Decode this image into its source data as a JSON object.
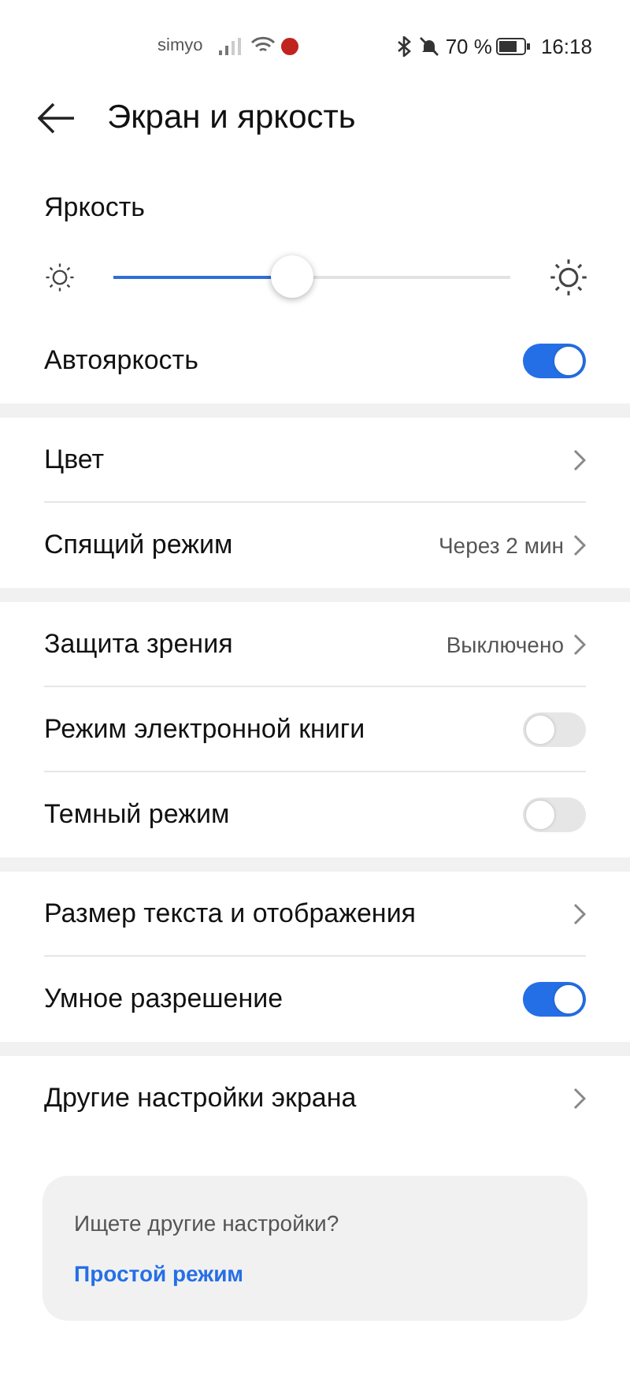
{
  "status_bar": {
    "carrier": "simyo",
    "battery": "70 %",
    "time": "16:18"
  },
  "header": {
    "title": "Экран и яркость"
  },
  "brightness": {
    "label": "Яркость",
    "level": 0.45
  },
  "auto_brightness": {
    "label": "Автояркость",
    "on": true
  },
  "sections": [
    {
      "rows": [
        {
          "kind": "link",
          "label": "Цвет"
        },
        {
          "kind": "link",
          "label": "Спящий режим",
          "value": "Через 2 мин"
        }
      ]
    },
    {
      "rows": [
        {
          "kind": "link",
          "label": "Защита зрения",
          "value": "Выключено"
        },
        {
          "kind": "toggle",
          "label": "Режим электронной книги",
          "on": false
        },
        {
          "kind": "toggle",
          "label": "Темный режим",
          "on": false
        }
      ]
    },
    {
      "rows": [
        {
          "kind": "link",
          "label": "Размер текста и отображения"
        },
        {
          "kind": "toggle",
          "label": "Умное разрешение",
          "on": true
        }
      ]
    },
    {
      "rows": [
        {
          "kind": "link",
          "label": "Другие настройки экрана"
        }
      ]
    }
  ],
  "suggestion": {
    "question": "Ищете другие настройки?",
    "link": "Простой режим"
  }
}
